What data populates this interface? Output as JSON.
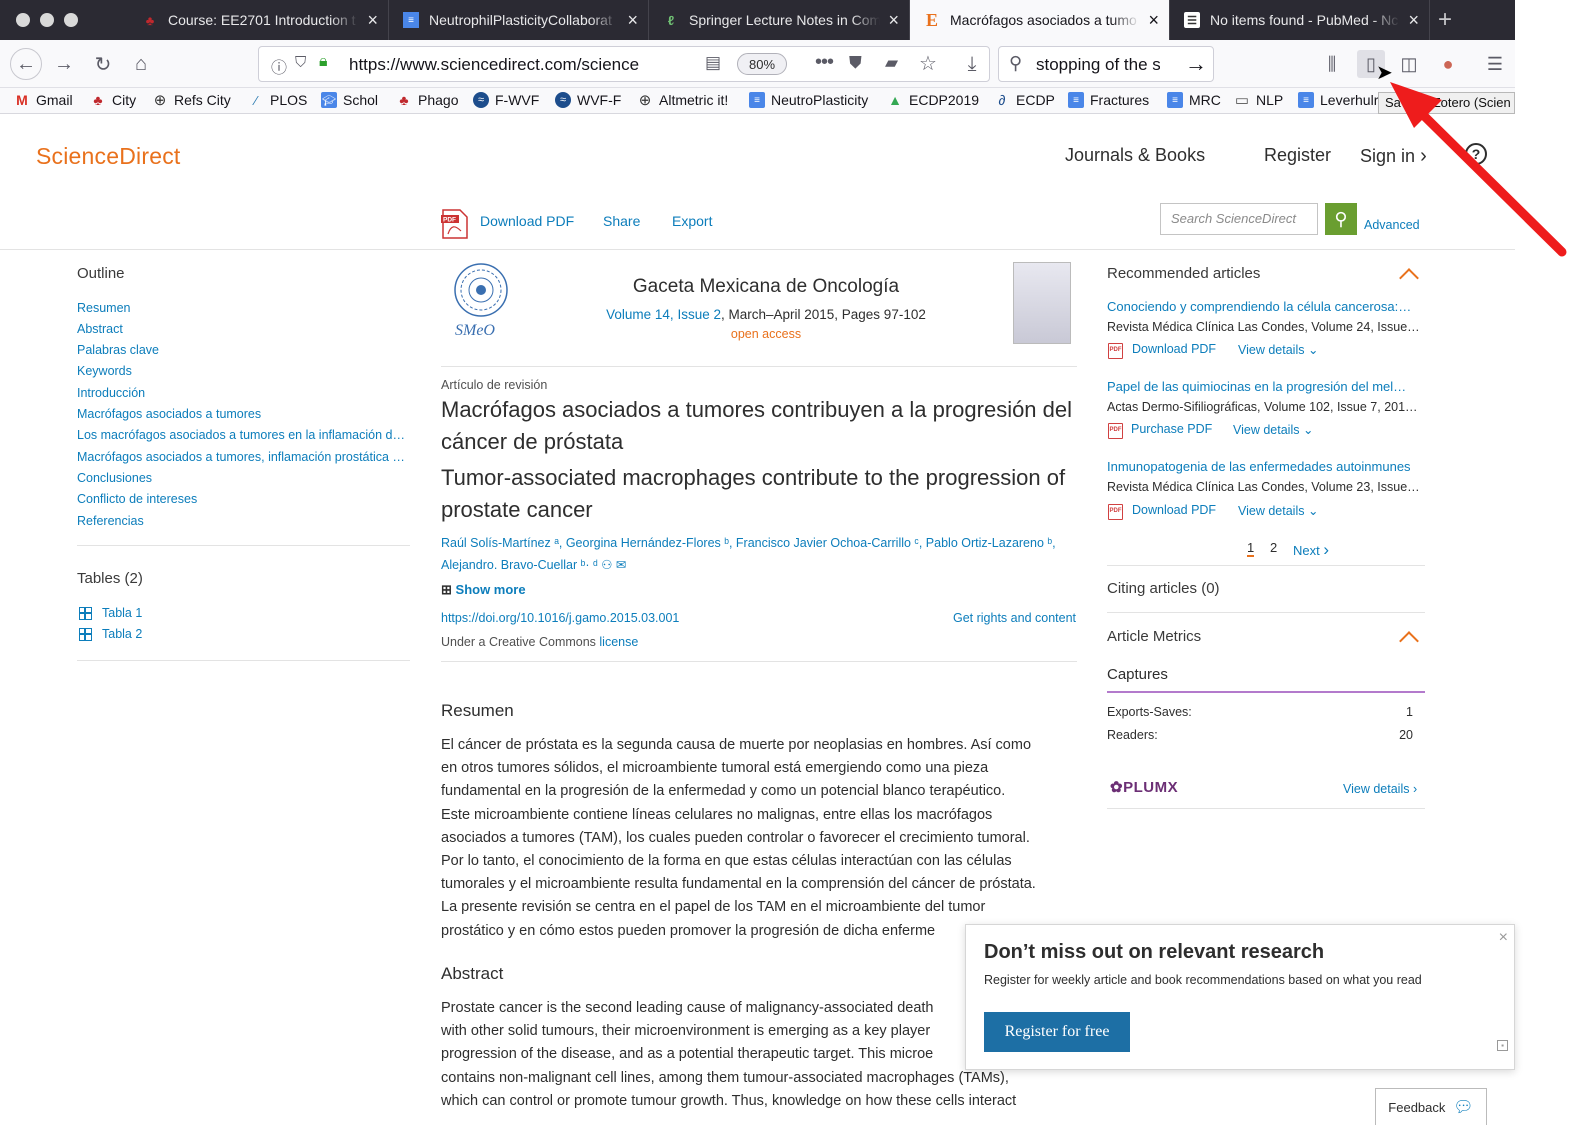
{
  "browser": {
    "tabs": [
      {
        "title": "Course: EE2701 Introduction t",
        "icon": "city-icon",
        "active": false
      },
      {
        "title": "NeutrophilPlasticityCollaborat",
        "icon": "docs-icon",
        "active": false
      },
      {
        "title": "Springer Lecture Notes in Com",
        "icon": "springer-icon",
        "active": false
      },
      {
        "title": "Macrófagos asociados a tumo",
        "icon": "elsevier-icon",
        "active": true
      },
      {
        "title": "No items found - PubMed - Nc",
        "icon": "pubmed-icon",
        "active": false
      }
    ],
    "url": "https://www.sciencedirect.com/science",
    "zoom": "80%",
    "search_query": "stopping of the sto",
    "tooltip": "Save to Zotero (Scien",
    "bookmarks": [
      "Gmail",
      "City",
      "Refs City",
      "PLOS",
      "Schol",
      "Phago",
      "F-WVF",
      "WVF-F",
      "Altmetric it!",
      "NeutroPlasticity",
      "ECDP2019",
      "ECDP",
      "Fractures",
      "MRC",
      "NLP",
      "Leverhulr"
    ]
  },
  "site": {
    "logo": "ScienceDirect",
    "nav": {
      "journals": "Journals & Books",
      "register": "Register",
      "signin": "Sign in"
    },
    "toolbar": {
      "download": "Download PDF",
      "share": "Share",
      "export": "Export",
      "search_placeholder": "Search ScienceDirect",
      "advanced": "Advanced"
    }
  },
  "outline": {
    "heading": "Outline",
    "items": [
      "Resumen",
      "Abstract",
      "Palabras clave",
      "Keywords",
      "Introducción",
      "Macrófagos asociados a tumores",
      "Los macrófagos asociados a tumores en la inflamación d…",
      "Macrófagos asociados a tumores, inflamación prostática …",
      "Conclusiones",
      "Conflicto de intereses",
      "Referencias"
    ],
    "tables_heading": "Tables (2)",
    "tables": [
      "Tabla 1",
      "Tabla 2"
    ]
  },
  "article": {
    "journal": "Gaceta Mexicana de Oncología",
    "volume_link": "Volume 14, Issue 2",
    "volume_rest": ", March–April 2015, Pages 97-102",
    "open_access": "open access",
    "type": "Artículo de revisión",
    "title_es": "Macrófagos asociados a tumores contribuyen a la progresión del cáncer de próstata",
    "title_en": "Tumor-associated macrophages contribute to the progression of prostate cancer",
    "authors_line1": "Raúl Solís-Martínez ᵃ, Georgina Hernández-Flores ᵇ, Francisco Javier Ochoa-Carrillo ᶜ, Pablo Ortiz-Lazareno ᵇ,",
    "authors_line2": "Alejandro. Bravo-Cuellar ᵇ· ᵈ ⚇ ✉",
    "show_more": "Show more",
    "doi": "https://doi.org/10.1016/j.gamo.2015.03.001",
    "rights": "Get rights and content",
    "license_prefix": "Under a Creative Commons ",
    "license_link": "license",
    "resumen_heading": "Resumen",
    "resumen_lines": [
      "El cáncer de próstata es la segunda causa de muerte por neoplasias en hombres. Así como",
      "en otros tumores sólidos, el microambiente tumoral está emergiendo como una pieza",
      "fundamental en la progresión de la enfermedad y como un potencial blanco terapéutico.",
      "Este microambiente contiene líneas celulares no malignas, entre ellas los macrófagos",
      "asociados a tumores (TAM), los cuales pueden controlar o favorecer el crecimiento tumoral.",
      "Por lo tanto, el conocimiento de la forma en que estas células interactúan con las células",
      "tumorales y el microambiente resulta fundamental en la comprensión del cáncer de próstata.",
      "La presente revisión se centra en el papel de los TAM en el microambiente del tumor",
      "prostático y en cómo estos pueden promover la progresión de dicha enferme"
    ],
    "abstract_heading": "Abstract",
    "abstract_lines": [
      "Prostate cancer is the second leading cause of malignancy-associated death",
      "with other solid tumours, their microenvironment is emerging as a key player",
      "progression of the disease, and as a potential therapeutic target. This microe",
      "contains non-malignant cell lines, among them tumour-associated macrophages (TAMs),",
      "which can control or promote tumour growth. Thus, knowledge on how these cells interact"
    ]
  },
  "recommended": {
    "heading": "Recommended articles",
    "items": [
      {
        "title": "Conociendo y comprendiendo la célula cancerosa:…",
        "source": "Revista Médica Clínica Las Condes, Volume 24, Issue…",
        "pdf": "Download PDF",
        "details": "View details"
      },
      {
        "title": "Papel de las quimiocinas en la progresión del mel…",
        "source": "Actas Dermo-Sifiliográficas, Volume 102, Issue 7, 201…",
        "pdf": "Purchase PDF",
        "details": "View details"
      },
      {
        "title": "Inmunopatogenia de las enfermedades autoinmunes",
        "source": "Revista Médica Clínica Las Condes, Volume 23, Issue…",
        "pdf": "Download PDF",
        "details": "View details"
      }
    ],
    "pages": [
      "1",
      "2"
    ],
    "next": "Next",
    "citing": "Citing articles (0)",
    "metrics_heading": "Article Metrics",
    "captures": "Captures",
    "exports_label": "Exports-Saves:",
    "exports_value": "1",
    "readers_label": "Readers:",
    "readers_value": "20",
    "plumx": "PLUMX",
    "plumx_details": "View details"
  },
  "popup": {
    "heading": "Don’t miss out on relevant research",
    "text": "Register for weekly article and book recommendations based on what you read",
    "button": "Register for free"
  },
  "feedback": "Feedback"
}
